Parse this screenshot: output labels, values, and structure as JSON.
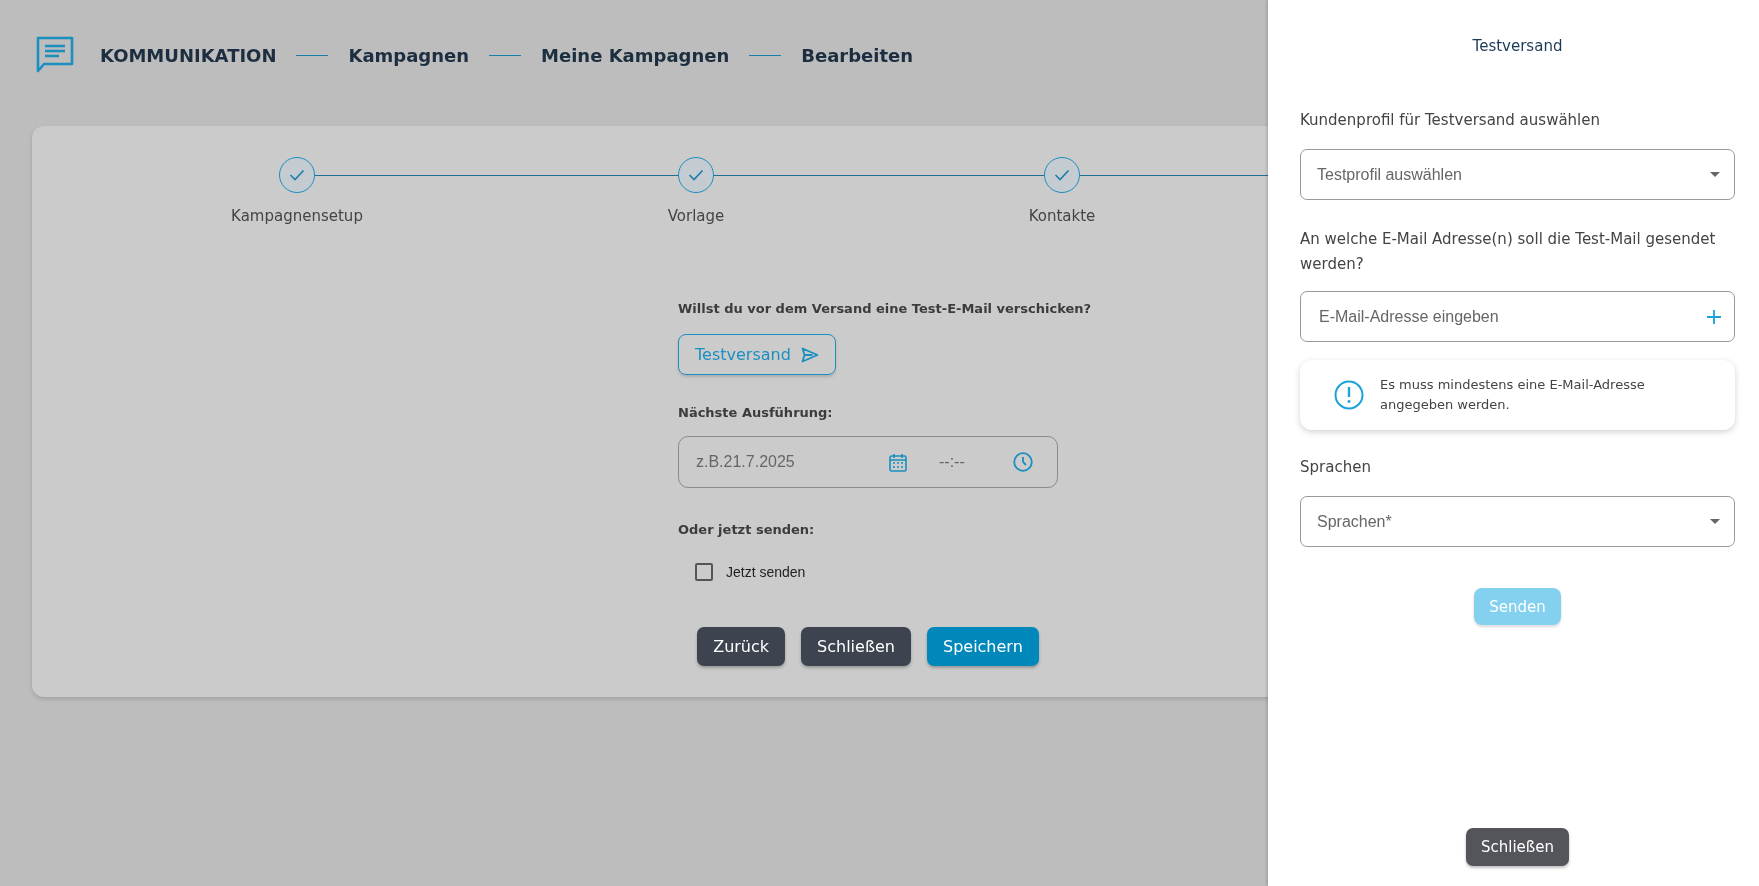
{
  "header": {
    "title": "KOMMUNIKATION",
    "breadcrumbs": [
      "Kampagnen",
      "Meine Kampagnen",
      "Bearbeiten"
    ]
  },
  "stepper": [
    {
      "label": "Kampagnensetup",
      "done": true
    },
    {
      "label": "Vorlage",
      "done": true
    },
    {
      "label": "Kontakte",
      "done": true
    }
  ],
  "form": {
    "question": "Willst du vor dem Versand eine Test-E-Mail verschicken?",
    "test_button": "Testversand",
    "next_run_label": "Nächste Ausführung:",
    "date_placeholder": "z.B.21.7.2025",
    "time_placeholder": "--:--",
    "send_now_label": "Oder jetzt senden:",
    "send_now_checkbox": {
      "label": "Jetzt senden",
      "checked": false
    }
  },
  "actions": [
    {
      "label": "Zurück",
      "kind": "secondary"
    },
    {
      "label": "Schließen",
      "kind": "secondary"
    },
    {
      "label": "Speichern",
      "kind": "primary"
    }
  ],
  "drawer": {
    "title": "Testversand",
    "profile_label": "Kundenprofil für Testversand auswählen",
    "profile_select": {
      "placeholder": "Testprofil auswählen"
    },
    "email_label": "An welche E-Mail Adresse(n) soll die Test-Mail gesendet werden?",
    "email_field": {
      "placeholder": "E-Mail-Adresse eingeben"
    },
    "alert": "Es muss mindestens eine E-Mail-Adresse angegeben werden.",
    "languages_label": "Sprachen",
    "languages_select": {
      "placeholder": "Sprachen*"
    },
    "send_button": {
      "label": "Senden",
      "disabled": true
    },
    "close_button": "Schließen"
  }
}
